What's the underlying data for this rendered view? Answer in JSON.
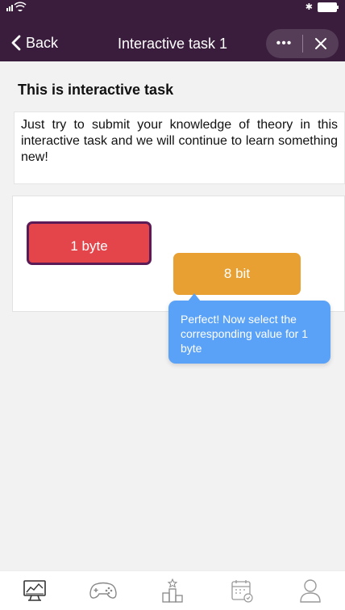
{
  "status_bar": {
    "signal": "📶",
    "bluetooth": "✱"
  },
  "header": {
    "back_label": "Back",
    "title": "Interactive task 1",
    "more_label": "•••"
  },
  "content": {
    "heading": "This is interactive task",
    "description": "Just try to submit your knowledge of theory in this interactive task and we will continue to learn something new!"
  },
  "task": {
    "chip_selected": "1 byte",
    "chip_option": "8 bit",
    "tooltip": "Perfect! Now select the corresponding value for 1 byte"
  },
  "tabs": [
    {
      "icon": "monitor-chart-icon"
    },
    {
      "icon": "gamepad-icon"
    },
    {
      "icon": "podium-icon"
    },
    {
      "icon": "calendar-icon"
    },
    {
      "icon": "user-icon"
    }
  ],
  "colors": {
    "header_bg": "#3a1d3c",
    "selected_chip": "#e3454b",
    "selected_chip_border": "#5a1b56",
    "option_chip": "#e9a033",
    "tooltip_bg": "#5aa2f7"
  }
}
